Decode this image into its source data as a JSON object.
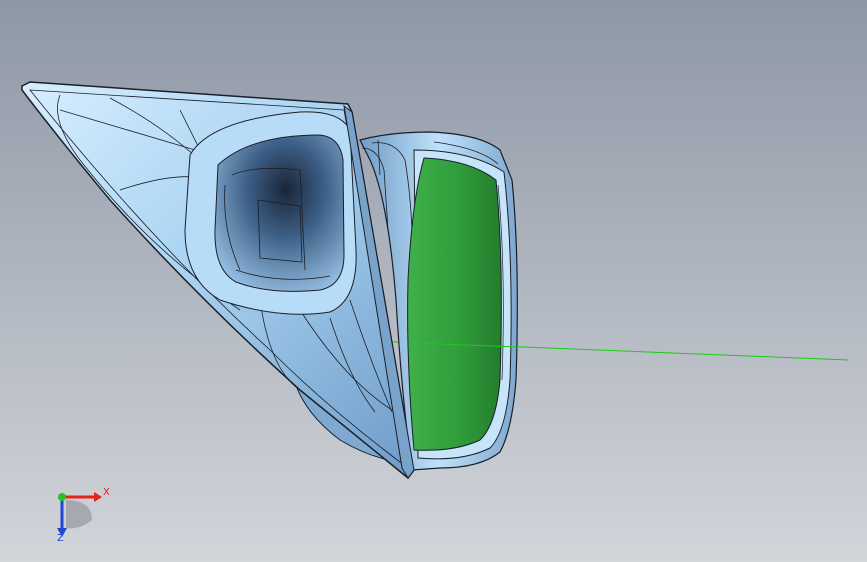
{
  "viewport": {
    "background_top": "#8e97a6",
    "background_bottom": "#d2d5da"
  },
  "model": {
    "body_color": "#a9d3f2",
    "body_shadow": "#5b86b3",
    "edge_color": "#1b1f27",
    "mirror_glass_color": "#2f9a3a"
  },
  "triad": {
    "x_label": "X",
    "z_label": "Z",
    "x_color": "#e0231c",
    "y_color": "#27c227",
    "z_color": "#2244d8"
  },
  "reference_axis_color": "#19cc19"
}
